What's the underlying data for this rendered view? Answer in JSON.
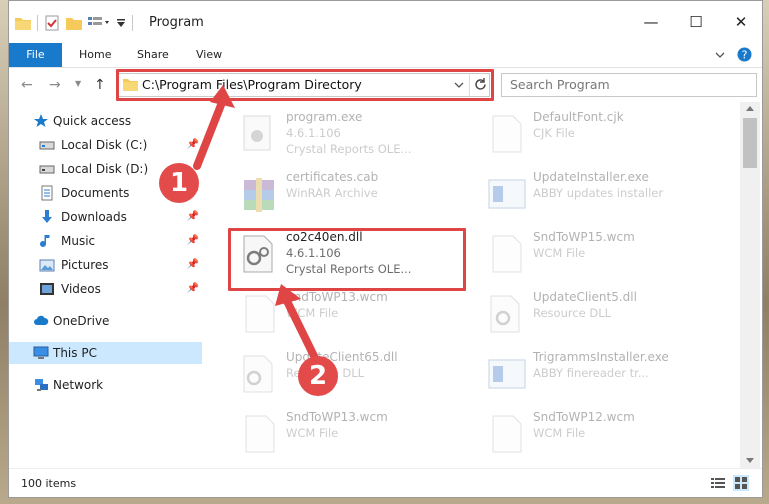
{
  "window": {
    "title": "Program",
    "minimize_glyph": "—",
    "maximize_glyph": "☐",
    "close_glyph": "✕"
  },
  "ribbon": {
    "tabs": [
      "File",
      "Home",
      "Share",
      "View"
    ]
  },
  "address": {
    "path": "C:\\Program Files\\Program Directory",
    "search_placeholder": "Search Program"
  },
  "nav": {
    "items": [
      {
        "label": "Quick access",
        "icon": "star-icon"
      },
      {
        "label": "Local Disk (C:)",
        "icon": "drive-icon"
      },
      {
        "label": "Local Disk (D:)",
        "icon": "drive-icon"
      },
      {
        "label": "Documents",
        "icon": "documents-icon"
      },
      {
        "label": "Downloads",
        "icon": "download-icon"
      },
      {
        "label": "Music",
        "icon": "music-icon"
      },
      {
        "label": "Pictures",
        "icon": "pictures-icon"
      },
      {
        "label": "Videos",
        "icon": "videos-icon"
      },
      {
        "label": "OneDrive",
        "icon": "cloud-icon"
      },
      {
        "label": "This PC",
        "icon": "computer-icon"
      },
      {
        "label": "Network",
        "icon": "network-icon"
      }
    ]
  },
  "files": {
    "left": [
      {
        "name": "program.exe",
        "line1": "4.6.1.106",
        "line2": "Crystal Reports OLE..."
      },
      {
        "name": "certificates.cab",
        "line1": "WinRAR Archive",
        "line2": ""
      },
      {
        "name": "co2c40en.dll",
        "line1": "4.6.1.106",
        "line2": "Crystal Reports OLE..."
      },
      {
        "name": "SndToWP13.wcm",
        "line1": "WCM File",
        "line2": ""
      },
      {
        "name": "UpdateClient65.dll",
        "line1": "Resource DLL",
        "line2": ""
      },
      {
        "name": "SndToWP13.wcm",
        "line1": "WCM File",
        "line2": ""
      }
    ],
    "right": [
      {
        "name": "DefaultFont.cjk",
        "line1": "CJK File",
        "line2": ""
      },
      {
        "name": "UpdateInstaller.exe",
        "line1": "ABBY updates installer",
        "line2": ""
      },
      {
        "name": "SndToWP15.wcm",
        "line1": "WCM File",
        "line2": ""
      },
      {
        "name": "UpdateClient5.dll",
        "line1": "Resource DLL",
        "line2": ""
      },
      {
        "name": "TrigrammsInstaller.exe",
        "line1": "ABBY finereader tr...",
        "line2": ""
      },
      {
        "name": "SndToWP12.wcm",
        "line1": "WCM File",
        "line2": ""
      }
    ]
  },
  "status": {
    "item_count": "100 items"
  },
  "annotations": {
    "step1": "1",
    "step2": "2",
    "color": "#e04545"
  },
  "colors": {
    "accent": "#1979ca",
    "selected_nav": "#cce8ff"
  }
}
